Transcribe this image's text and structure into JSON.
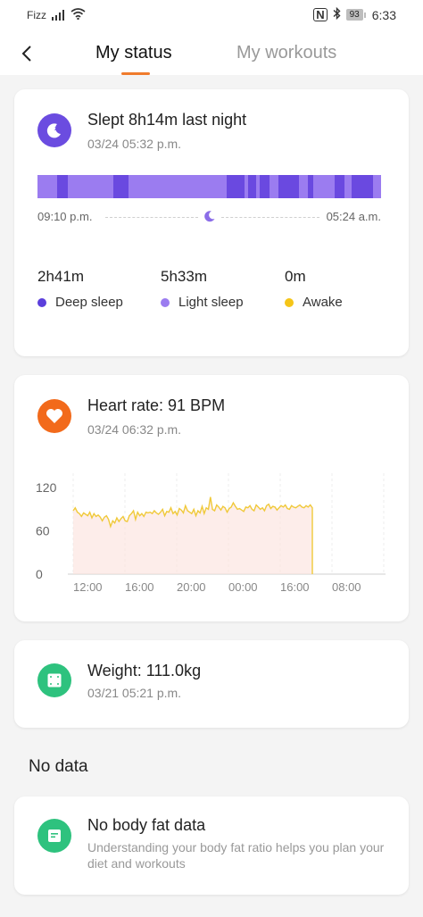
{
  "statusbar": {
    "carrier": "Fizz",
    "battery": "93",
    "time": "6:33"
  },
  "tabs": [
    {
      "label": "My status",
      "active": true
    },
    {
      "label": "My workouts",
      "active": false
    }
  ],
  "sleep": {
    "title": "Slept 8h14m last night",
    "date": "03/24 05:32 p.m.",
    "start_time": "09:10 p.m.",
    "end_time": "05:24 a.m.",
    "segments": [
      {
        "type": "light",
        "w": 22
      },
      {
        "type": "deep",
        "w": 12
      },
      {
        "type": "light",
        "w": 50
      },
      {
        "type": "deep",
        "w": 17
      },
      {
        "type": "light",
        "w": 108
      },
      {
        "type": "deep",
        "w": 20
      },
      {
        "type": "light",
        "w": 4
      },
      {
        "type": "deep",
        "w": 9
      },
      {
        "type": "light",
        "w": 4
      },
      {
        "type": "deep",
        "w": 11
      },
      {
        "type": "light",
        "w": 10
      },
      {
        "type": "deep",
        "w": 22
      },
      {
        "type": "light",
        "w": 10
      },
      {
        "type": "deep",
        "w": 6
      },
      {
        "type": "light",
        "w": 24
      },
      {
        "type": "deep",
        "w": 11
      },
      {
        "type": "light",
        "w": 8
      },
      {
        "type": "deep",
        "w": 23
      },
      {
        "type": "light",
        "w": 9
      }
    ],
    "stats": [
      {
        "value": "2h41m",
        "label": "Deep sleep",
        "color": "#5b3fdc"
      },
      {
        "value": "5h33m",
        "label": "Light sleep",
        "color": "#9b7cf0"
      },
      {
        "value": "0m",
        "label": "Awake",
        "color": "#f5c518"
      }
    ],
    "colors": {
      "deep": "#6a49e0",
      "light": "#9b7cf0"
    }
  },
  "heart": {
    "title": "Heart rate: 91 BPM",
    "date": "03/24 06:32 p.m."
  },
  "chart_data": {
    "type": "area",
    "y_ticks": [
      "120",
      "60",
      "0"
    ],
    "x_ticks": [
      "12:00",
      "16:00",
      "20:00",
      "00:00",
      "16:00",
      "08:00"
    ],
    "ylim": [
      0,
      140
    ],
    "values": [
      88,
      92,
      86,
      84,
      80,
      85,
      83,
      81,
      86,
      78,
      84,
      80,
      82,
      79,
      74,
      79,
      81,
      76,
      66,
      74,
      71,
      78,
      73,
      77,
      80,
      74,
      73,
      81,
      84,
      88,
      76,
      86,
      81,
      84,
      80,
      86,
      85,
      86,
      84,
      88,
      85,
      83,
      86,
      90,
      81,
      87,
      86,
      92,
      84,
      87,
      82,
      91,
      89,
      85,
      95,
      88,
      86,
      84,
      90,
      81,
      88,
      85,
      94,
      84,
      92,
      90,
      107,
      90,
      88,
      96,
      93,
      89,
      94,
      92,
      86,
      91,
      93,
      99,
      94,
      90,
      91,
      89,
      87,
      93,
      92,
      95,
      90,
      88,
      96,
      93,
      90,
      92,
      88,
      95,
      97,
      91,
      94,
      93,
      89,
      92,
      95,
      93,
      96,
      91,
      90,
      95,
      93,
      92,
      94,
      96,
      93,
      92,
      95,
      93,
      96,
      92,
      0
    ],
    "color": "#f0c93a",
    "fill": "#fbe1dc"
  },
  "weight": {
    "title": "Weight: 111.0kg",
    "date": "03/21 05:21 p.m."
  },
  "nodata": {
    "label": "No data"
  },
  "bodyfat": {
    "title": "No body fat data",
    "desc": "Understanding your body fat ratio helps you plan your diet and workouts"
  },
  "icons": {
    "sleep": "moon-icon",
    "heart": "heart-icon",
    "weight": "scale-icon",
    "bodyfat": "note-icon"
  }
}
